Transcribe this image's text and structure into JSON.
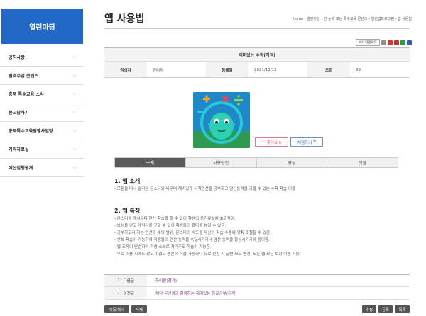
{
  "brand": "열린마당",
  "sidebar": {
    "items": [
      {
        "label": "공지사항"
      },
      {
        "label": "원격수업 콘텐츠"
      },
      {
        "label": "충북 특수교육 소식"
      },
      {
        "label": "묻고답하기"
      },
      {
        "label": "충북특수교육원행사일정"
      },
      {
        "label": "기타자료실"
      },
      {
        "label": "예산집행공개"
      }
    ]
  },
  "page": {
    "title": "앱 사용법",
    "breadcrumb": "Home › 열린마당 › 한 눈에 보는 특수교육 콘텐츠 › 열린앱프로그램 › 앱 사용법"
  },
  "tools": {
    "font_size_label": "보기 다운로드"
  },
  "post": {
    "subject": "재미있는 수학(지적)",
    "author_label": "작성자",
    "author": "관리자",
    "date_label": "등록일",
    "date": "2021/11/12",
    "views_label": "조회",
    "views": "39",
    "like_label": "좋아요 0",
    "experience_label": "체험하기"
  },
  "tabs": [
    {
      "label": "소개",
      "active": true
    },
    {
      "label": "사용방법",
      "active": false
    },
    {
      "label": "영상",
      "active": false
    },
    {
      "label": "댓글",
      "active": false
    }
  ],
  "sections": {
    "s1_title": "1. 앱 소개",
    "s1_body": "- 모험을 떠나 슬라임 몬스터와 싸우며 재미있게 사칙연산을 공부하고 암산능력을 키울 수 있는 수학 학습 어플",
    "s2_title": "2. 앱 특징",
    "s2_lines": [
      "- 몬스터를 깨치우며 연산 학습을 할 수 있어 학생의 동기유발에 효과적임.",
      "- 보상을 얻고 캐릭터를 꾸밀 수 있어 학생들의 흥미를 높일 수 있음.",
      "- 공부하고자 하는 연산과 수의 범위, 몬스터의 속도를 자신의 학습 수준에 맞춰 조절할 수 있음.",
      "- 반복 학습이 가능하여 학생들의 연산 능력을 숙달시키거나 암산 능력을 향상시키기에 용이함.",
      "- 앱 조작이 단순하여 학생 스스로 자기주도 학습이 가능함.",
      "- 무료 이용 시에도 광고가 없고 충분히 학습 가능하나 유료 전환 시 답변 모드 변경, 모든 앱 모든 보상 이용 가능"
    ]
  },
  "nav": {
    "next_label": "다음글",
    "next_title": "하이핀(청각)",
    "prev_label": "이전글",
    "prev_title": "허당 몬선생과 함께하는 재미있는 한글공부(지적)"
  },
  "buttons": {
    "move_copy": "이동/복사",
    "delete": "삭제",
    "edit": "수정",
    "register": "등록",
    "list": "목록"
  },
  "colors": {
    "brand": "#2268c6",
    "active_tab": "#5a5a5a",
    "like": "#e05566",
    "experience": "#3566b3",
    "link": "#7c2c8c"
  }
}
